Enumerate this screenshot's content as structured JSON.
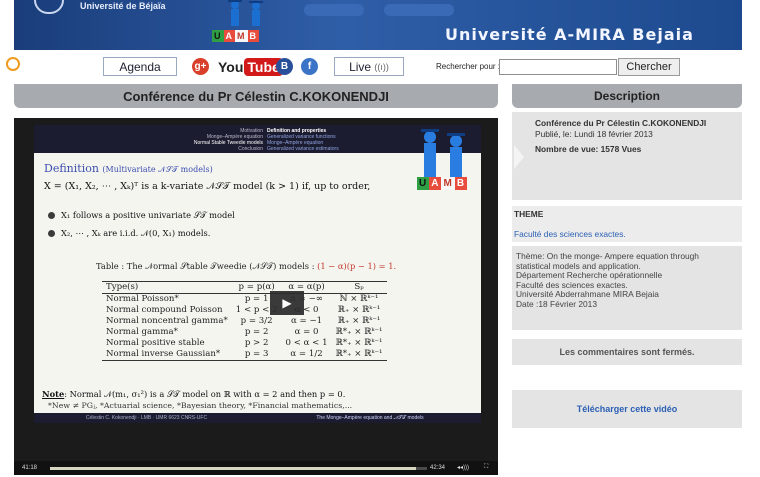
{
  "header": {
    "university_small": "Université de Béjaïa",
    "title": "Université A-MIRA Bejaia",
    "logo_letters": [
      "U",
      "A",
      "M",
      "B"
    ],
    "logo_colors": [
      "#2ea043",
      "#e74c3c",
      "#f7f7f7",
      "#e74c3c"
    ]
  },
  "nav": {
    "agenda": "Agenda",
    "gplus": "g+",
    "youtube_you": "You",
    "youtube_tube": "Tube",
    "blogger": "B",
    "facebook": "f",
    "live": "Live",
    "live_signal": "((ı))",
    "search_label": "Rechercher pour :",
    "search_value": "",
    "search_button": "Chercher"
  },
  "left": {
    "conference_title": "Conférence du Pr Célestin C.KOKONENDJI"
  },
  "slide": {
    "top_left": [
      "Motivation",
      "Monge–Ampère equation",
      "Normal Stable Tweedie models",
      "Conclusion"
    ],
    "top_right": [
      "Definition and properties",
      "Generalized variance functions",
      "Monge–Ampère equation",
      "Generalized variance estimators"
    ],
    "definition_title": "Definition",
    "definition_subtitle": "(Multivariate 𝒩𝒮𝒯 models)",
    "definition_text": "X = (X₁, X₂, ⋯ , Xₖ)ᵀ is a k-variate 𝒩𝒮𝒯 model (k > 1) if, up to order,",
    "bullet1": "X₁ follows a positive univariate 𝒮𝒯 model",
    "bullet2": "X₂, ⋯ , Xₖ are i.i.d. 𝒩(0, X₁) models.",
    "table_caption": "Table : The 𝒩ormal 𝒮table 𝒯weedie (𝒩𝒮𝒯) models :",
    "table_caption_eq": "(1 − α)(p − 1) = 1.",
    "table_headers": [
      "Type(s)",
      "p = p(α)",
      "α = α(p)",
      "Sₚ"
    ],
    "table_rows": [
      [
        "Normal Poisson*",
        "p = 1",
        "α = −∞",
        "ℕ × ℝᵏ⁻¹"
      ],
      [
        "Normal compound Poisson",
        "1 < p < 2",
        "α < 0",
        "ℝ₊ × ℝᵏ⁻¹"
      ],
      [
        "Normal noncentral gamma*",
        "p = 3/2",
        "α = −1",
        "ℝ₊ × ℝᵏ⁻¹"
      ],
      [
        "Normal gamma*",
        "p = 2",
        "α = 0",
        "ℝ*₊ × ℝᵏ⁻¹"
      ],
      [
        "Normal positive stable",
        "p > 2",
        "0 < α < 1",
        "ℝ*₊ × ℝᵏ⁻¹"
      ],
      [
        "Normal inverse Gaussian*",
        "p = 3",
        "α = 1/2",
        "ℝ*₊ × ℝᵏ⁻¹"
      ]
    ],
    "note_label": "Note",
    "note_text": ": Normal 𝒩(m₁, σ₁²) is a 𝒮𝒯 model on ℝ with α = 2 and then p = 0.",
    "refs": "*New ≠ PGⱼ, *Actuarial science, *Bayesian theory, *Financial mathematics,...",
    "footer_left": "Célestin C. Kokonendji · LMB · UMR 6623 CNRS-UFC",
    "footer_right": "The Monge–Ampère equation and 𝒩𝒮𝒯 models"
  },
  "player": {
    "elapsed": "41:18",
    "duration": "42:34",
    "progress_fraction": 0.97,
    "play_symbol": "▶",
    "volume_symbol": "◂◂)))",
    "fullscreen_symbol": "⛶"
  },
  "right": {
    "description_title": "Description",
    "info_title": "Conférence du Pr Célestin C.KOKONENDJI",
    "info_date": "Publié, le: Lundi 18 février 2013",
    "info_views": "Nombre de vue: 1578 Vues",
    "theme_heading": "THEME",
    "theme_value": "Faculté des sciences exactes.",
    "theme_lines": [
      "Thème: On the monge- Ampere equation through",
      "statistical models and application.",
      "Département Recherche opérationnelle",
      "Faculté des sciences exactes.",
      "Université Abderrahmane MIRA Bejaia",
      "Date :18 Février 2013"
    ],
    "comments": "Les commentaires sont fermés.",
    "download": "Télécharger cette vidéo"
  },
  "colors": {
    "header_blue": "#2f5ea8",
    "panel_grey": "#a7abb0",
    "link_blue": "#2b5fb3",
    "slide_title_blue": "#3b4fae"
  }
}
